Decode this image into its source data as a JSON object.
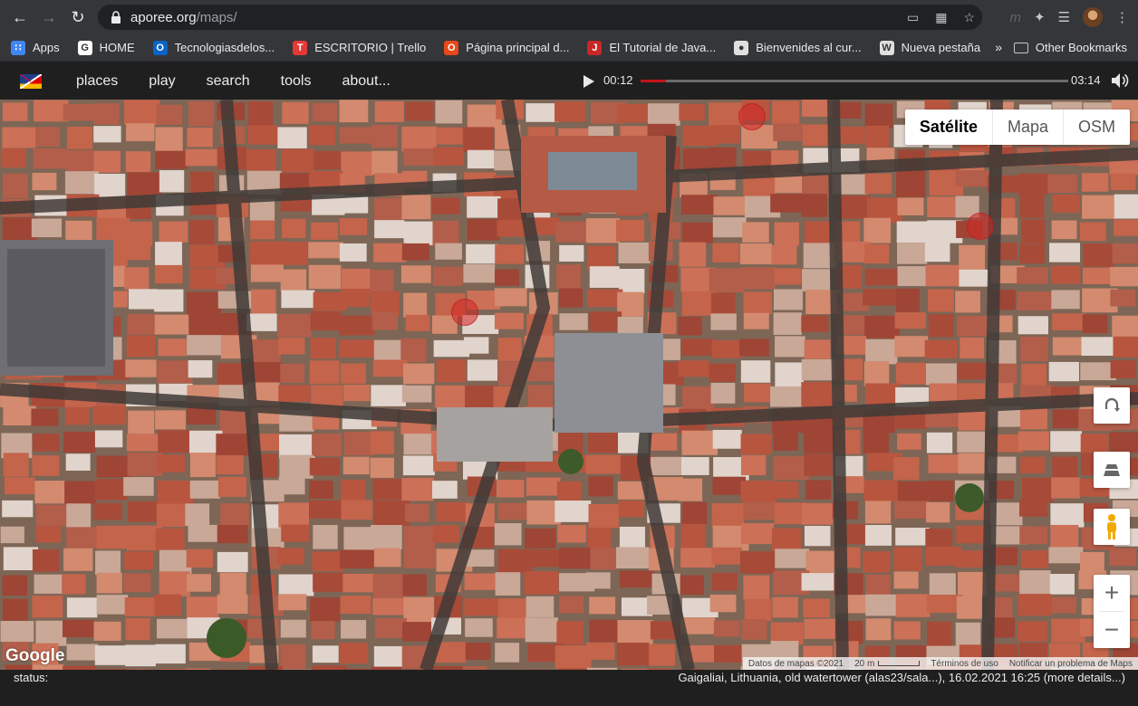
{
  "browser": {
    "url_host": "aporee.org",
    "url_path": "/maps/",
    "bookmarks": [
      {
        "label": "Apps",
        "icon": "apps-grid-icon",
        "color": "#4285f4"
      },
      {
        "label": "HOME",
        "icon": "google-icon",
        "color": "#ffffff"
      },
      {
        "label": "Tecnologiasdelos...",
        "icon": "outlook-icon",
        "color": "#0a64c8"
      },
      {
        "label": "ESCRITORIO | Trello",
        "icon": "trello-icon",
        "color": "#e53935"
      },
      {
        "label": "Página principal d...",
        "icon": "office-icon",
        "color": "#e64a19"
      },
      {
        "label": "El Tutorial de Java...",
        "icon": "java-icon",
        "color": "#c62828"
      },
      {
        "label": "Bienvenides al cur...",
        "icon": "globe-icon",
        "color": "#e0e0e0"
      },
      {
        "label": "Nueva pestaña",
        "icon": "wordpress-icon",
        "color": "#e0e0e0"
      }
    ],
    "more_label": "»",
    "other_bookmarks": "Other Bookmarks"
  },
  "app": {
    "menu": [
      "places",
      "play",
      "search",
      "tools",
      "about..."
    ],
    "player": {
      "current": "00:12",
      "total": "03:14",
      "progress": 0.06
    }
  },
  "map": {
    "types": [
      "Satélite",
      "Mapa",
      "OSM"
    ],
    "active_type": "Satélite",
    "logo": "Google",
    "attribution": {
      "data": "Datos de mapas ©2021",
      "scale": "20 m",
      "terms": "Términos de uso",
      "report": "Notificar un problema de Maps"
    },
    "zoom_in": "+",
    "zoom_out": "−"
  },
  "status": {
    "label": "status:",
    "text": "Gaigaliai, Lithuania, old watertower (alas23/sala...), 16.02.2021 16:25 (more details...)"
  },
  "colors": {
    "accent": "#c4141a",
    "marker": "#d62424"
  }
}
